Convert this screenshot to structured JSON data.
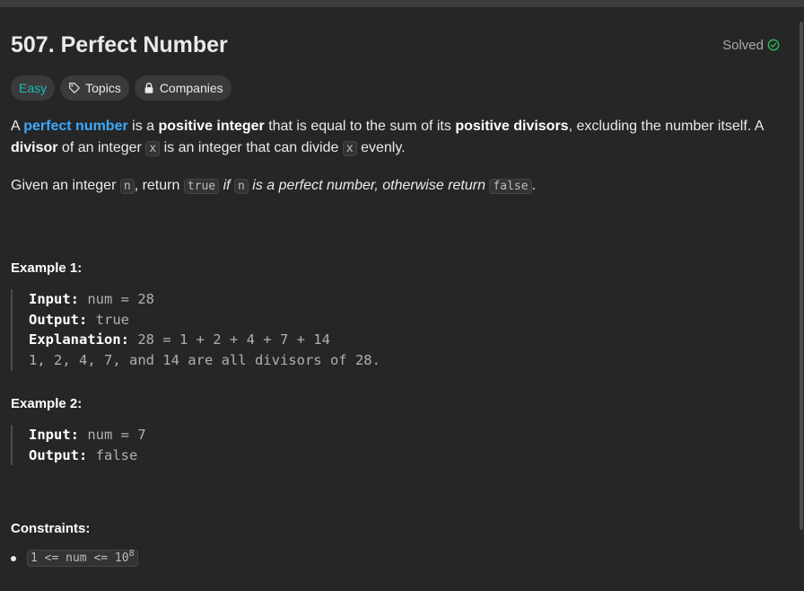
{
  "problem": {
    "title": "507. Perfect Number",
    "status": "Solved"
  },
  "tags": {
    "difficulty": "Easy",
    "topics": "Topics",
    "companies": "Companies"
  },
  "description": {
    "p1": {
      "a": "A ",
      "perfect_number": "perfect number",
      "b": " is a ",
      "positive_integer": "positive integer",
      "c": " that is equal to the sum of its ",
      "positive_divisors": "positive divisors",
      "d": ", excluding the number itself. A ",
      "divisor": "divisor",
      "e": " of an integer ",
      "x1": "x",
      "f": " is an integer that can divide ",
      "x2": "x",
      "g": " evenly."
    },
    "p2": {
      "a": "Given an integer ",
      "n1": "n",
      "b": ", return ",
      "true": "true",
      "c": " if ",
      "n2": "n",
      "d": " is a perfect number, otherwise return ",
      "false": "false",
      "e": "."
    }
  },
  "examples": [
    {
      "title": "Example 1:",
      "input_label": "Input:",
      "input": " num = 28",
      "output_label": "Output:",
      "output": " true",
      "explanation_label": "Explanation:",
      "explanation": " 28 = 1 + 2 + 4 + 7 + 14",
      "explanation_line2": "1, 2, 4, 7, and 14 are all divisors of 28."
    },
    {
      "title": "Example 2:",
      "input_label": "Input:",
      "input": " num = 7",
      "output_label": "Output:",
      "output": " false"
    }
  ],
  "constraints": {
    "title": "Constraints:",
    "items": [
      {
        "text": "1 <= num <= 10",
        "sup": "8"
      }
    ]
  },
  "colors": {
    "easy": "#1cbaba",
    "link": "#3da9fc",
    "solved_check": "#2cbb5d",
    "background": "#262626"
  },
  "icons": {
    "solved": "check-circle-icon",
    "topics": "tag-icon",
    "companies": "lock-icon"
  }
}
